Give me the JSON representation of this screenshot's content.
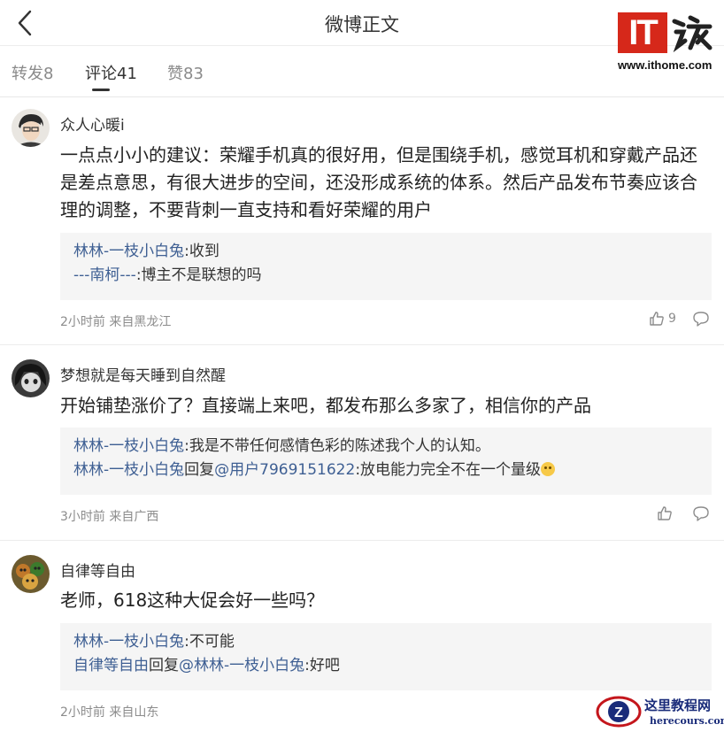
{
  "header": {
    "title": "微博正文"
  },
  "logo": {
    "brand_text": "IT",
    "brand_zhi": "之家",
    "url": "www.ithome.com"
  },
  "tabs": [
    {
      "label": "转发8"
    },
    {
      "label": "评论41"
    },
    {
      "label": "赞83"
    }
  ],
  "active_tab": "评论41",
  "comments": [
    {
      "user": "众人心暖i",
      "text": "一点点小小的建议：荣耀手机真的很好用，但是围绕手机，感觉耳机和穿戴产品还是差点意思，有很大进步的空间，还没形成系统的体系。然后产品发布节奏应该合理的调整，不要背刺一直支持和看好荣耀的用户",
      "replies": [
        {
          "author": "林林-一枝小白兔",
          "sep": ":",
          "text": "收到"
        },
        {
          "author": "---南柯---",
          "sep": ":",
          "text": "博主不是联想的吗"
        }
      ],
      "meta": "2小时前 来自黑龙江",
      "likes": "9"
    },
    {
      "user": "梦想就是每天睡到自然醒",
      "text": "开始铺垫涨价了？直接端上来吧，都发布那么多家了，相信你的产品",
      "replies": [
        {
          "author": "林林-一枝小白兔",
          "sep": ":",
          "text": "我是不带任何感情色彩的陈述我个人的认知。"
        },
        {
          "author": "林林-一枝小白兔",
          "mid": "回复",
          "mention": "@用户7969151622",
          "sep": ":",
          "text": "放电能力完全不在一个量级"
        }
      ],
      "meta": "3小时前 来自广西",
      "likes": ""
    },
    {
      "user": "自律等自由",
      "text": "老师，618这种大促会好一些吗？",
      "replies": [
        {
          "author": "林林-一枝小白兔",
          "sep": ":",
          "text": "不可能"
        },
        {
          "author": "自律等自由",
          "mid": "回复",
          "mention": "@林林-一枝小白兔",
          "sep": ":",
          "text": "好吧"
        }
      ],
      "meta": "2小时前 来自山东",
      "likes": ""
    }
  ],
  "watermark": {
    "line1": "这里教程网",
    "line2": "herecours.com"
  },
  "colors": {
    "link": "#3e5f93",
    "brand_red": "#d6281a",
    "reply_bg": "#f5f5f5"
  },
  "icons": [
    "back-arrow-icon",
    "thumbs-up-icon",
    "comment-bubble-icon",
    "emoji-icon"
  ]
}
